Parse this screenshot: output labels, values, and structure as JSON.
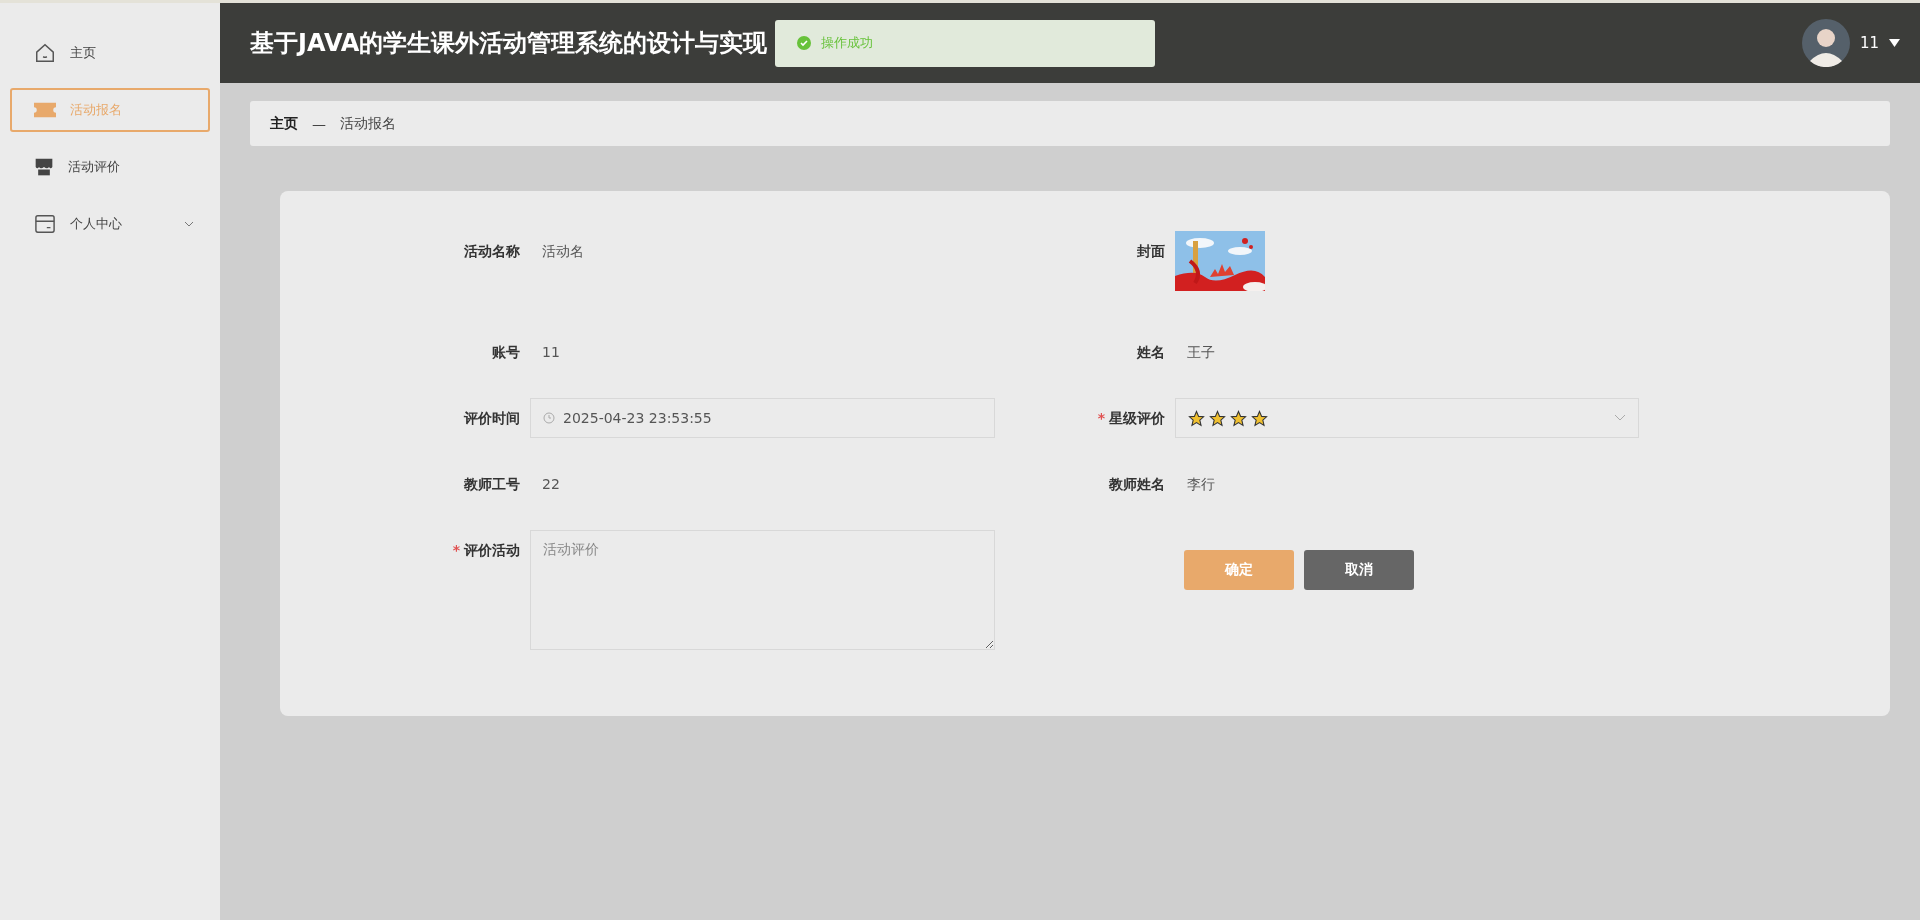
{
  "sidebar": {
    "items": [
      {
        "label": "主页",
        "selected": false
      },
      {
        "label": "活动报名",
        "selected": true
      },
      {
        "label": "活动评价",
        "selected": false
      },
      {
        "label": "个人中心",
        "selected": false,
        "expanded": false
      }
    ]
  },
  "header": {
    "title": "基于JAVA的学生课外活动管理系统的设计与实现",
    "toast": {
      "message": "操作成功"
    },
    "user": {
      "name": "11"
    }
  },
  "breadcrumb": {
    "items": [
      "主页",
      "活动报名"
    ],
    "separator": "—"
  },
  "form": {
    "required_mark": "*",
    "fields": [
      {
        "kind": "text",
        "label": "活动名称",
        "value": "活动名",
        "required": false
      },
      {
        "kind": "picture",
        "label": "封面",
        "required": false
      },
      {
        "kind": "text",
        "label": "账号",
        "value": "11",
        "required": false
      },
      {
        "kind": "text",
        "label": "姓名",
        "value": "王子",
        "required": false
      },
      {
        "kind": "datetime",
        "label": "评价时间",
        "value": "2025-04-23 23:53:55",
        "required": false
      },
      {
        "kind": "rating",
        "label": "星级评价",
        "stars": 4,
        "required": true
      },
      {
        "kind": "text",
        "label": "教师工号",
        "value": "22",
        "required": false
      },
      {
        "kind": "text",
        "label": "教师姓名",
        "value": "李行",
        "required": false
      },
      {
        "kind": "textarea",
        "label": "评价活动",
        "placeholder": "活动评价",
        "required": true
      }
    ],
    "buttons": [
      {
        "label": "确定",
        "kind": "primary"
      },
      {
        "label": "取消",
        "kind": "secondary"
      }
    ]
  }
}
